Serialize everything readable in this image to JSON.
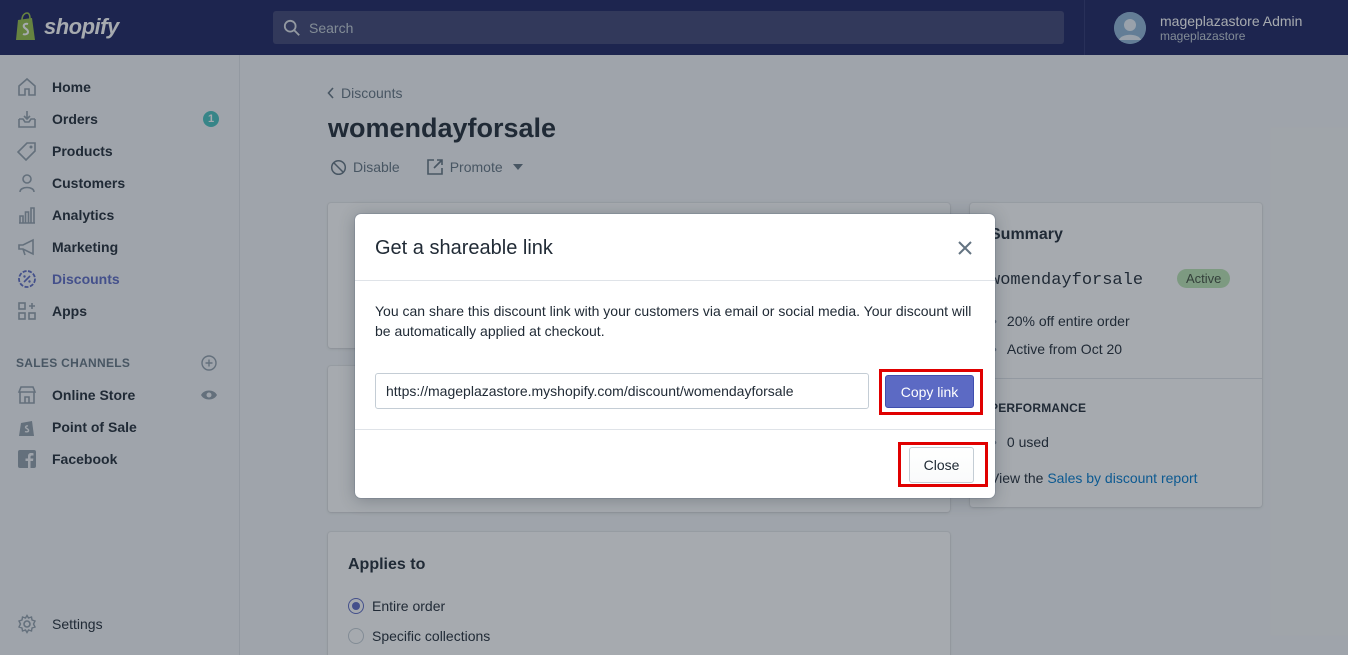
{
  "brand": {
    "logo_text": "shopify"
  },
  "search": {
    "placeholder": "Search"
  },
  "account": {
    "name": "mageplazastore Admin",
    "store": "mageplazastore"
  },
  "sidebar": {
    "items": [
      {
        "label": "Home",
        "icon": "home-icon"
      },
      {
        "label": "Orders",
        "icon": "orders-icon",
        "badge": "1"
      },
      {
        "label": "Products",
        "icon": "tag-icon"
      },
      {
        "label": "Customers",
        "icon": "person-icon"
      },
      {
        "label": "Analytics",
        "icon": "bar-chart-icon"
      },
      {
        "label": "Marketing",
        "icon": "megaphone-icon"
      },
      {
        "label": "Discounts",
        "icon": "discount-icon",
        "active": true
      },
      {
        "label": "Apps",
        "icon": "apps-icon"
      }
    ],
    "sales_channels_title": "SALES CHANNELS",
    "channels": [
      {
        "label": "Online Store",
        "icon": "store-icon"
      },
      {
        "label": "Point of Sale",
        "icon": "pos-icon"
      },
      {
        "label": "Facebook",
        "icon": "facebook-icon"
      }
    ],
    "settings_label": "Settings"
  },
  "page": {
    "breadcrumb": "Discounts",
    "title": "womendayforsale",
    "actions": {
      "disable": "Disable",
      "promote": "Promote"
    }
  },
  "applies_to": {
    "heading": "Applies to",
    "options": [
      "Entire order",
      "Specific collections"
    ]
  },
  "summary": {
    "title": "Summary",
    "code": "womendayforsale",
    "status": "Active",
    "details": [
      "20% off entire order",
      "Active from Oct 20"
    ],
    "performance_title": "PERFORMANCE",
    "used": "0 used",
    "report_prefix": "View the",
    "report_link": "Sales by discount report"
  },
  "modal": {
    "title": "Get a shareable link",
    "description": "You can share this discount link with your customers via email or social media. Your discount will be automatically applied at checkout.",
    "link": "https://mageplazastore.myshopify.com/discount/womendayforsale",
    "copy_label": "Copy link",
    "close_label": "Close"
  },
  "colors": {
    "accent": "#5c6ac4",
    "topbar": "#1c2260",
    "highlight": "#e00000",
    "badge": "#47c1bf",
    "active_badge": "#bbe5b3"
  }
}
